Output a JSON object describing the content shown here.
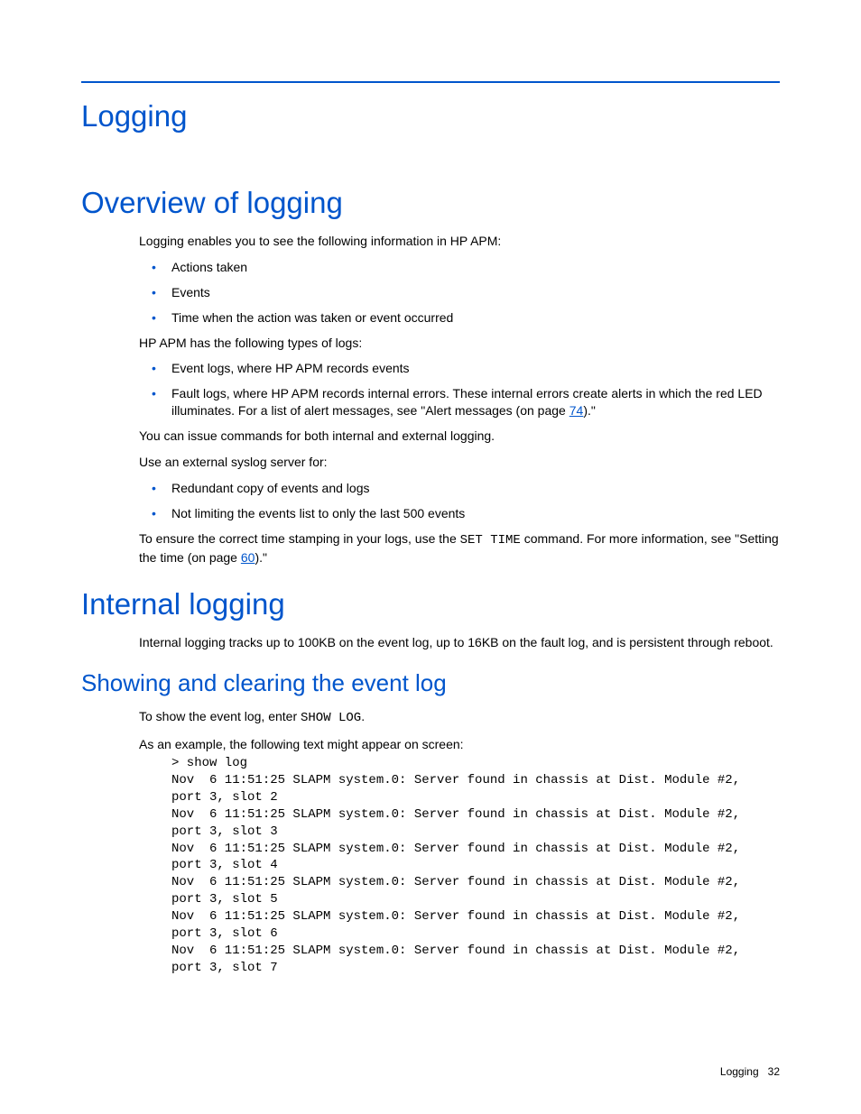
{
  "chapter_title": "Logging",
  "section_overview": {
    "heading": "Overview of logging",
    "intro": "Logging enables you to see the following information in HP APM:",
    "bullets1": {
      "b0": "Actions taken",
      "b1": "Events",
      "b2": "Time when the action was taken or event occurred"
    },
    "types_intro": "HP APM has the following types of logs:",
    "bullets2": {
      "b0": "Event logs, where HP APM records events",
      "b1_pre": "Fault logs, where HP APM records internal errors. These internal errors create alerts in which the red LED illuminates. For a list of alert messages, see \"Alert messages (on page ",
      "b1_link": "74",
      "b1_post": ").\""
    },
    "p_both": "You can issue commands for both internal and external logging.",
    "p_syslog": "Use an external syslog server for:",
    "bullets3": {
      "b0": "Redundant copy of events and logs",
      "b1": "Not limiting the events list to only the last 500 events"
    },
    "timestamp": {
      "pre": "To ensure the correct time stamping in your logs, use the ",
      "code": "SET TIME",
      "mid": " command. For more information, see \"Setting the time (on page ",
      "link": "60",
      "post": ").\""
    }
  },
  "section_internal": {
    "heading": "Internal logging",
    "p": "Internal logging tracks up to 100KB on the event log, up to 16KB on the fault log, and is persistent through reboot."
  },
  "section_show": {
    "heading": "Showing and clearing the event log",
    "p1_pre": "To show the event log, enter ",
    "p1_code": "SHOW LOG",
    "p1_post": ".",
    "p2": "As an example, the following text might appear on screen:",
    "log": "> show log\nNov  6 11:51:25 SLAPM system.0: Server found in chassis at Dist. Module #2,\nport 3, slot 2\nNov  6 11:51:25 SLAPM system.0: Server found in chassis at Dist. Module #2,\nport 3, slot 3\nNov  6 11:51:25 SLAPM system.0: Server found in chassis at Dist. Module #2,\nport 3, slot 4\nNov  6 11:51:25 SLAPM system.0: Server found in chassis at Dist. Module #2,\nport 3, slot 5\nNov  6 11:51:25 SLAPM system.0: Server found in chassis at Dist. Module #2,\nport 3, slot 6\nNov  6 11:51:25 SLAPM system.0: Server found in chassis at Dist. Module #2,\nport 3, slot 7"
  },
  "footer": {
    "label": "Logging",
    "page": "32"
  }
}
